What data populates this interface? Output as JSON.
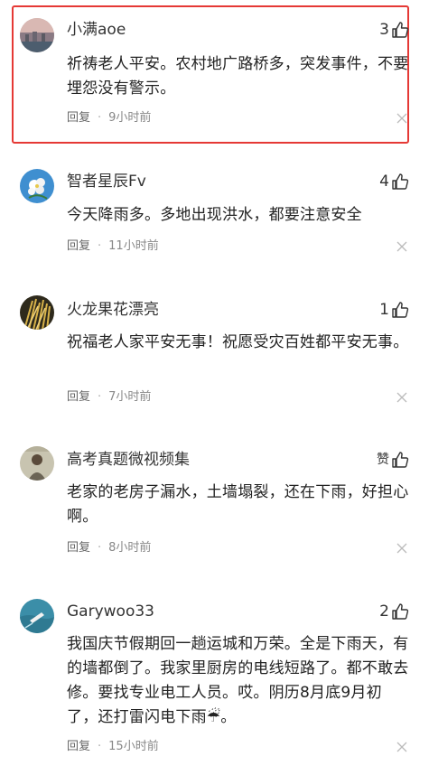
{
  "comments": [
    {
      "user": "小满aoe",
      "likes": "3",
      "text": "祈祷老人平安。农村地广路桥多，突发事件，不要埋怨没有警示。",
      "reply": "回复",
      "dot": "·",
      "time": "9小时前",
      "highlighted": true,
      "avatar": "sunset-photo-avatar"
    },
    {
      "user": "智者星辰Fv",
      "likes": "4",
      "text": "今天降雨多。多地出现洪水，都要注意安全",
      "reply": "回复",
      "dot": "·",
      "time": "11小时前",
      "avatar": "white-flower-avatar"
    },
    {
      "user": "火龙果花漂亮",
      "likes": "1",
      "text": "祝福老人家平安无事！祝愿受灾百姓都平安无事。",
      "reply": "回复",
      "dot": "·",
      "time": "7小时前",
      "avatar": "golden-grass-avatar"
    },
    {
      "user": "高考真题微视频集",
      "likes": "赞",
      "text": "老家的老房子漏水，土墙塌裂，还在下雨，好担心啊。",
      "reply": "回复",
      "dot": "·",
      "time": "8小时前",
      "avatar": "portrait-avatar"
    },
    {
      "user": "Garywoo33",
      "likes": "2",
      "text": "我国庆节假期回一趟运城和万荣。全是下雨天，有的墙都倒了。我家里厨房的电线短路了。都不敢去修。要找专业电工人员。哎。阴历8月底9月初了，还打雷闪电下雨☔。",
      "reply": "回复",
      "dot": "·",
      "time": "15小时前",
      "avatar": "boat-on-sea-avatar"
    }
  ],
  "colors": {
    "highlight_border": "#e53935",
    "text": "#222222",
    "meta": "#666666"
  }
}
